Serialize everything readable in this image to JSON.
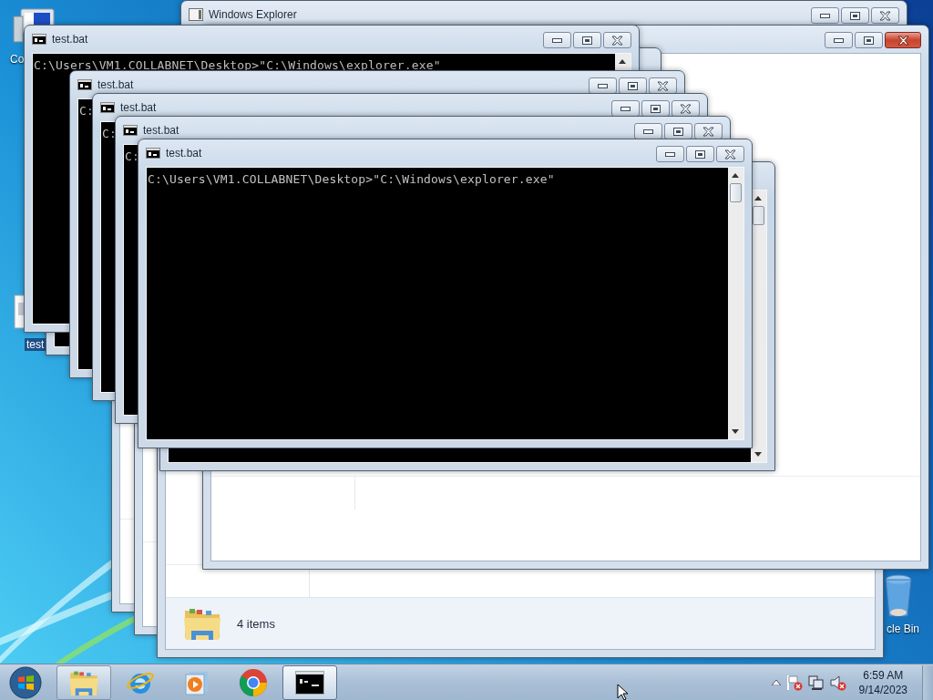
{
  "desktop_icons": [
    {
      "kind": "computer",
      "label": "Co",
      "selected": false
    },
    {
      "kind": "batch-file",
      "label": "test",
      "selected": true
    },
    {
      "kind": "recycle-bin",
      "label": "cle Bin",
      "selected": false
    }
  ],
  "explorer_windows": [
    {
      "title": "Windows Explorer",
      "active": false
    },
    {
      "status": "4 items"
    },
    {
      "active": true
    }
  ],
  "console_windows": [
    {
      "title": "test.bat",
      "lines": [
        "C:\\Users\\VM1.COLLABNET\\Desktop>\"C:\\Windows\\explorer.exe\""
      ]
    },
    {
      "title": "test.bat",
      "lines": [
        "C:"
      ]
    },
    {
      "title": "test.bat",
      "lines": [
        "C:"
      ]
    },
    {
      "title": "test.bat",
      "lines": [
        "C:"
      ]
    },
    {
      "title": "test.bat",
      "lines": [
        "C:\\Users\\VM1.COLLABNET\\Desktop>\"C:\\Windows\\explorer.exe\""
      ]
    }
  ],
  "taskbar": {
    "buttons": [
      {
        "kind": "explorer",
        "running": true,
        "selected": false
      },
      {
        "kind": "internet-explorer",
        "running": false,
        "selected": false
      },
      {
        "kind": "media-player",
        "running": false,
        "selected": false
      },
      {
        "kind": "chrome",
        "running": false,
        "selected": false
      },
      {
        "kind": "command-prompt",
        "running": true,
        "selected": true
      }
    ],
    "time": "6:59 AM",
    "date": "9/14/2023"
  }
}
